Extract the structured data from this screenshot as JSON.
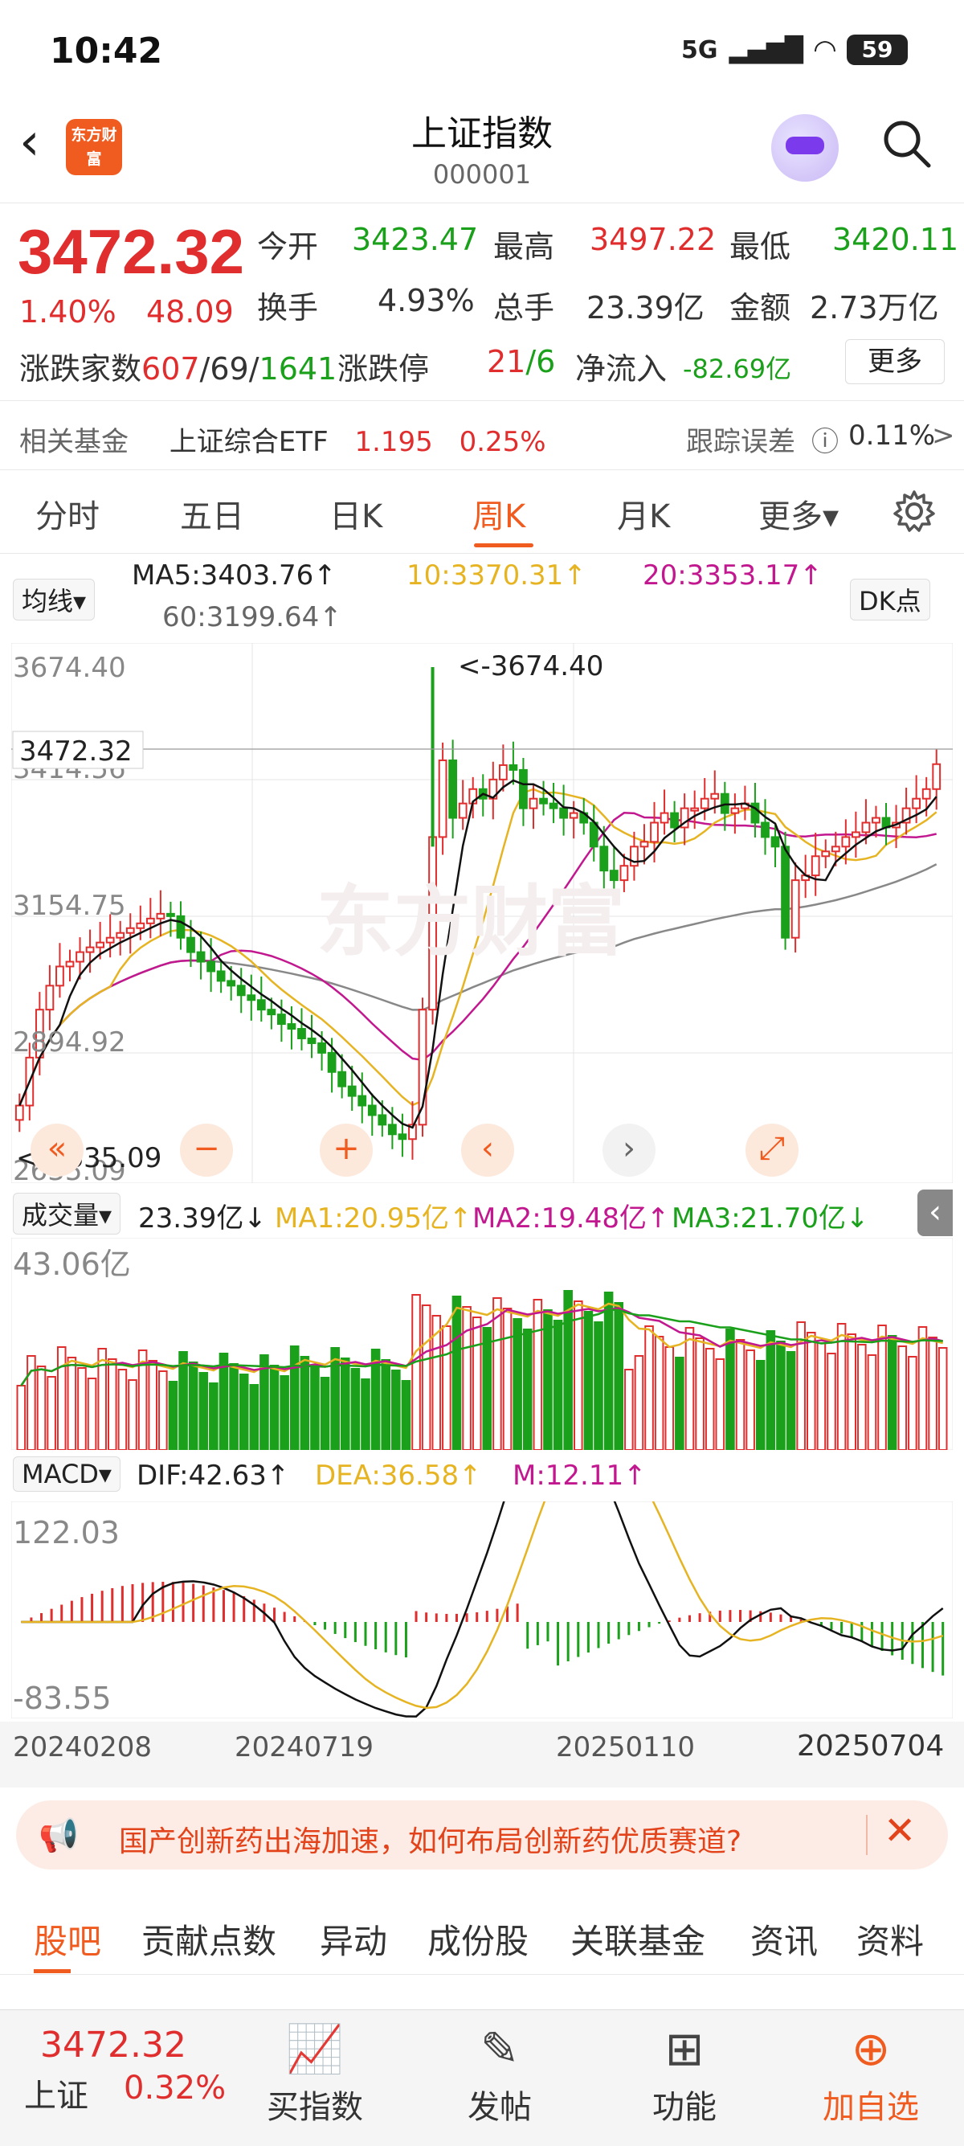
{
  "status_bar": {
    "time": "10:42",
    "network": "5G",
    "battery": "59"
  },
  "header": {
    "title": "上证指数",
    "code": "000001",
    "logo_text": "东方财富"
  },
  "quote": {
    "price": "3472.32",
    "pct": "1.40%",
    "change": "48.09",
    "open_label": "今开",
    "open": "3423.47",
    "high_label": "最高",
    "high": "3497.22",
    "low_label": "最低",
    "low": "3420.11",
    "turnover_label": "换手",
    "turnover": "4.93%",
    "volume_label": "总手",
    "volume": "23.39亿",
    "amount_label": "金额",
    "amount": "2.73万亿",
    "advances_label": "涨跌家数",
    "advances_up": "607",
    "advances_flat": "/69/",
    "advances_down": "1641",
    "limit_label": "涨跌停",
    "limit_up": "21",
    "limit_down": "/6",
    "netflow_label": "净流入",
    "netflow": "-82.69亿",
    "more": "更多"
  },
  "fund": {
    "label": "相关基金",
    "name": "上证综合ETF",
    "price": "1.195",
    "pct": "0.25%",
    "tracking_label": "跟踪误差",
    "tracking": "0.11%",
    "arrow": ">"
  },
  "tabs": [
    "分时",
    "五日",
    "日K",
    "周K",
    "月K",
    "更多▾"
  ],
  "active_tab": "周K",
  "ma": {
    "selector": "均线▾",
    "ma5": "MA5:3403.76↑",
    "ma10": "10:3370.31↑",
    "ma20": "20:3353.17↑",
    "ma60": "60:3199.64↑",
    "dk": "DK点"
  },
  "kline": {
    "y_labels": [
      "3674.40",
      "3414.56",
      "3154.75",
      "2894.92",
      "2635.09"
    ],
    "current_price_tag": "3472.32",
    "max_marker": "<-3674.40",
    "min_marker": "<-2635.09"
  },
  "volume": {
    "selector": "成交量▾",
    "value": "23.39亿↓",
    "ma1": "MA1:20.95亿↑",
    "ma2": "MA2:19.48亿↑",
    "ma3": "MA3:21.70亿↓",
    "max_label": "43.06亿"
  },
  "macd": {
    "selector": "MACD▾",
    "dif": "DIF:42.63↑",
    "dea": "DEA:36.58↑",
    "m": "M:12.11↑",
    "max_label": "122.03",
    "min_label": "-83.55"
  },
  "x_axis": [
    "20240208",
    "20240719",
    "20250110",
    "20250704"
  ],
  "banner": {
    "text": "国产创新药出海加速，如何布局创新药优质赛道?"
  },
  "bottom_tabs": [
    "股吧",
    "贡献点数",
    "异动",
    "成份股",
    "关联基金",
    "资讯",
    "资料"
  ],
  "footer": {
    "price": "3472.32",
    "name": "上证",
    "pct": "0.32%",
    "buttons": [
      "买指数",
      "发帖",
      "功能",
      "加自选"
    ]
  },
  "colors": {
    "up": "#e02d2d",
    "down": "#1aa01a",
    "accent": "#f05b1f",
    "ma5": "#111111",
    "ma10": "#e6b422",
    "ma20": "#c2188f",
    "ma60": "#888888"
  }
}
